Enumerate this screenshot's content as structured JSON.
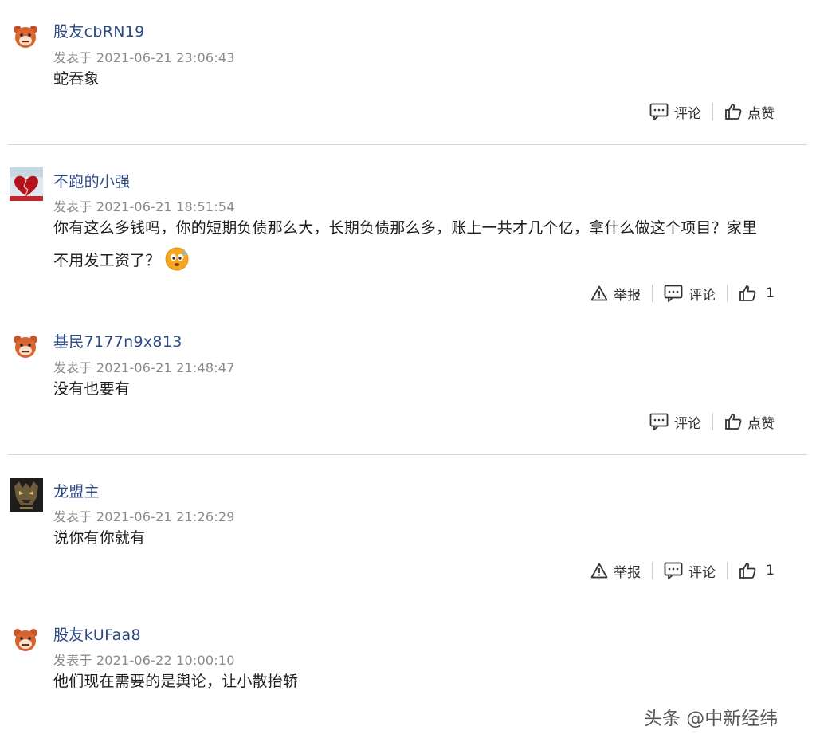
{
  "comments": [
    {
      "username": "股友cbRN19",
      "timestamp": "发表于 2021-06-21 23:06:43",
      "body": "蛇吞象",
      "actions": {
        "comment": "评论",
        "like": "点赞"
      }
    },
    {
      "username": "不跑的小强",
      "timestamp": "发表于 2021-06-21 18:51:54",
      "body_line1": "你有这么多钱吗，你的短期负债那么大，长期负债那么多，账上一共才几个亿，拿什么做这个项目？家里",
      "body_line2": "不用发工资了？",
      "emoji": "sweat-worried-emoji",
      "actions": {
        "report": "举报",
        "comment": "评论",
        "like_count": "1"
      }
    },
    {
      "username": "基民7177n9x813",
      "timestamp": "发表于 2021-06-21 21:48:47",
      "body": "没有也要有",
      "actions": {
        "comment": "评论",
        "like": "点赞"
      }
    },
    {
      "username": "龙盟主",
      "timestamp": "发表于 2021-06-21 21:26:29",
      "body": "说你有你就有",
      "actions": {
        "report": "举报",
        "comment": "评论",
        "like_count": "1"
      }
    },
    {
      "username": "股友kUFaa8",
      "timestamp": "发表于 2021-06-22 10:00:10",
      "body": "他们现在需要的是舆论，让小散抬轿"
    }
  ],
  "watermark": "头条 @中新经纬",
  "colors": {
    "username": "#2d4a85",
    "timestamp": "#8a8a8a",
    "divider": "#d8d8d8",
    "avatar_bear": "#d45a2a"
  }
}
